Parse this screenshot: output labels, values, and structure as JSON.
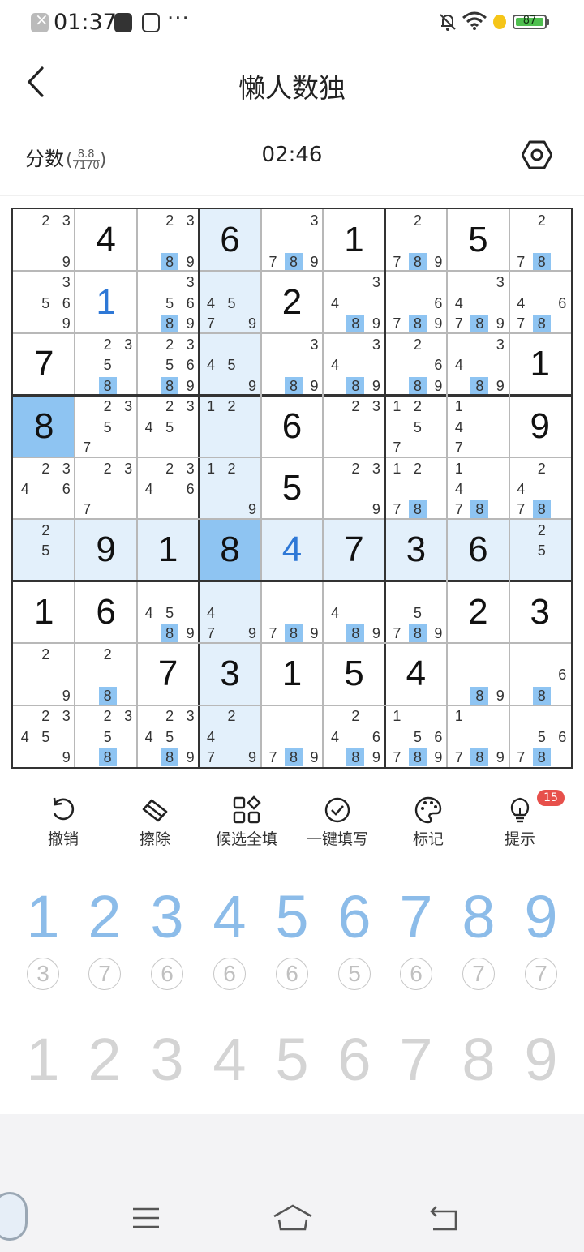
{
  "status_bar": {
    "time": "01:37",
    "battery": "87",
    "more": "···"
  },
  "header": {
    "title": "懒人数独",
    "back_icon": "back-arrow-icon"
  },
  "info": {
    "score_label": "分数",
    "score_num": "8.8",
    "score_den": "7170",
    "timer": "02:46",
    "settings_icon": "hex-settings-icon"
  },
  "board": {
    "rows": [
      [
        {
          "c": [
            2,
            3,
            9
          ]
        },
        {
          "v": 4
        },
        {
          "c": [
            2,
            3,
            8,
            9
          ],
          "h": [
            8
          ]
        },
        {
          "v": 6
        },
        {
          "c": [
            3,
            7,
            8,
            9
          ],
          "h": [
            8
          ]
        },
        {
          "v": 1
        },
        {
          "c": [
            2,
            7,
            8,
            9
          ],
          "h": [
            8
          ]
        },
        {
          "v": 5
        },
        {
          "c": [
            2,
            7,
            8
          ],
          "h": [
            8
          ]
        }
      ],
      [
        {
          "c": [
            3,
            5,
            6,
            9
          ]
        },
        {
          "v": 1,
          "u": true
        },
        {
          "c": [
            3,
            5,
            6,
            8,
            9
          ],
          "h": [
            8
          ]
        },
        {
          "c": [
            4,
            5,
            7,
            9
          ]
        },
        {
          "v": 2
        },
        {
          "c": [
            3,
            4,
            8,
            9
          ],
          "h": [
            8
          ]
        },
        {
          "c": [
            6,
            7,
            8,
            9
          ],
          "h": [
            8
          ]
        },
        {
          "c": [
            3,
            4,
            7,
            8,
            9
          ],
          "h": [
            8
          ]
        },
        {
          "c": [
            4,
            6,
            7,
            8
          ],
          "h": [
            8
          ]
        }
      ],
      [
        {
          "v": 7
        },
        {
          "c": [
            2,
            3,
            5,
            8
          ],
          "h": [
            8
          ]
        },
        {
          "c": [
            2,
            3,
            5,
            6,
            8,
            9
          ],
          "h": [
            8
          ]
        },
        {
          "c": [
            4,
            5,
            9
          ]
        },
        {
          "c": [
            3,
            8,
            9
          ],
          "h": [
            8
          ]
        },
        {
          "c": [
            3,
            4,
            8,
            9
          ],
          "h": [
            8
          ]
        },
        {
          "c": [
            2,
            6,
            8,
            9
          ],
          "h": [
            8
          ]
        },
        {
          "c": [
            3,
            4,
            8,
            9
          ],
          "h": [
            8
          ]
        },
        {
          "v": 1
        }
      ],
      [
        {
          "v": 8
        },
        {
          "c": [
            2,
            3,
            5,
            7
          ]
        },
        {
          "c": [
            2,
            3,
            4,
            5
          ]
        },
        {
          "c": [
            1,
            2
          ]
        },
        {
          "v": 6
        },
        {
          "c": [
            2,
            3
          ]
        },
        {
          "c": [
            1,
            2,
            5,
            7
          ]
        },
        {
          "c": [
            1,
            4,
            7
          ]
        },
        {
          "v": 9
        }
      ],
      [
        {
          "c": [
            2,
            3,
            4,
            6
          ]
        },
        {
          "c": [
            2,
            3,
            7
          ]
        },
        {
          "c": [
            2,
            3,
            4,
            6
          ]
        },
        {
          "c": [
            1,
            2,
            9
          ]
        },
        {
          "v": 5
        },
        {
          "c": [
            2,
            3,
            9
          ]
        },
        {
          "c": [
            1,
            2,
            7,
            8
          ],
          "h": [
            8
          ]
        },
        {
          "c": [
            1,
            4,
            7,
            8
          ],
          "h": [
            8
          ]
        },
        {
          "c": [
            2,
            4,
            7,
            8
          ],
          "h": [
            8
          ]
        }
      ],
      [
        {
          "c": [
            2,
            5
          ]
        },
        {
          "v": 9
        },
        {
          "v": 1
        },
        {
          "v": 8
        },
        {
          "v": 4,
          "u": true
        },
        {
          "v": 7
        },
        {
          "v": 3
        },
        {
          "v": 6
        },
        {
          "c": [
            2,
            5
          ]
        }
      ],
      [
        {
          "v": 1
        },
        {
          "v": 6
        },
        {
          "c": [
            4,
            5,
            8,
            9
          ],
          "h": [
            8
          ]
        },
        {
          "c": [
            4,
            7,
            9
          ]
        },
        {
          "c": [
            7,
            8,
            9
          ],
          "h": [
            8
          ]
        },
        {
          "c": [
            4,
            8,
            9
          ],
          "h": [
            8
          ]
        },
        {
          "c": [
            5,
            7,
            8,
            9
          ],
          "h": [
            8
          ]
        },
        {
          "v": 2
        },
        {
          "v": 3
        }
      ],
      [
        {
          "c": [
            2,
            9
          ]
        },
        {
          "c": [
            2,
            8
          ],
          "h": [
            8
          ]
        },
        {
          "v": 7
        },
        {
          "v": 3
        },
        {
          "v": 1
        },
        {
          "v": 5
        },
        {
          "v": 4
        },
        {
          "c": [
            8,
            9
          ],
          "h": [
            8
          ]
        },
        {
          "c": [
            6,
            8
          ],
          "h": [
            8
          ]
        }
      ],
      [
        {
          "c": [
            2,
            3,
            4,
            5,
            9
          ]
        },
        {
          "c": [
            2,
            3,
            5,
            8
          ],
          "h": [
            8
          ]
        },
        {
          "c": [
            2,
            3,
            4,
            5,
            8,
            9
          ],
          "h": [
            8
          ]
        },
        {
          "c": [
            2,
            4,
            7,
            9
          ]
        },
        {
          "c": [
            7,
            8,
            9
          ],
          "h": [
            8
          ]
        },
        {
          "c": [
            2,
            4,
            6,
            8,
            9
          ],
          "h": [
            8
          ]
        },
        {
          "c": [
            1,
            5,
            6,
            7,
            8,
            9
          ],
          "h": [
            8
          ]
        },
        {
          "c": [
            1,
            7,
            8,
            9
          ],
          "h": [
            8
          ]
        },
        {
          "c": [
            5,
            6,
            7,
            8
          ],
          "h": [
            8
          ]
        }
      ]
    ],
    "selected": {
      "row": 5,
      "col": 3
    },
    "colors": {
      "selected": "#8ec4f2",
      "peer": "#e3f0fb",
      "candidate_highlight": "#8ec4f2",
      "user_digit": "#2e78d6"
    }
  },
  "tools": [
    {
      "label": "撤销",
      "icon": "undo-icon"
    },
    {
      "label": "擦除",
      "icon": "eraser-icon"
    },
    {
      "label": "候选全填",
      "icon": "fill-candidates-icon"
    },
    {
      "label": "一键填写",
      "icon": "check-circle-icon"
    },
    {
      "label": "标记",
      "icon": "palette-icon"
    },
    {
      "label": "提示",
      "icon": "lightbulb-icon"
    }
  ],
  "hint_badge": "15",
  "number_pad": [
    "1",
    "2",
    "3",
    "4",
    "5",
    "6",
    "7",
    "8",
    "9"
  ],
  "remaining_counts": [
    "3",
    "7",
    "6",
    "6",
    "6",
    "5",
    "6",
    "7",
    "7"
  ],
  "pencil_pad": [
    "1",
    "2",
    "3",
    "4",
    "5",
    "6",
    "7",
    "8",
    "9"
  ],
  "nav_bar": {
    "menu_icon": "menu-icon",
    "home_icon": "home-icon",
    "back_icon": "back-icon"
  }
}
